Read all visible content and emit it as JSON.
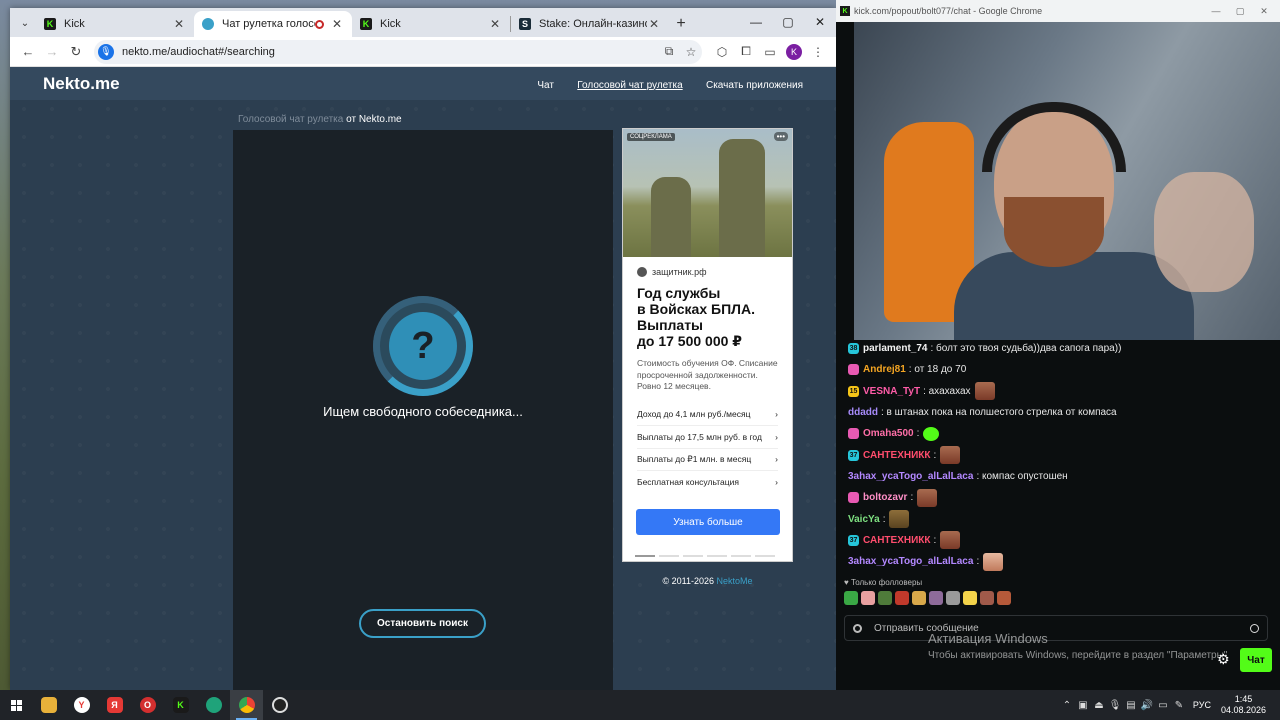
{
  "browser": {
    "tabs": [
      {
        "title": "Kick",
        "icon": "kick-icon",
        "active": false
      },
      {
        "title": "Чат рулетка голосовая — ",
        "icon": "nekto-icon",
        "active": true,
        "recording": true
      },
      {
        "title": "Kick",
        "icon": "kick-icon",
        "active": false
      },
      {
        "title": "Stake: Онлайн-казино и ставк",
        "icon": "stake-icon",
        "active": false
      }
    ],
    "url": "nekto.me/audiochat#/searching",
    "profile_initial": "K"
  },
  "site": {
    "logo": "Nekto.me",
    "nav": [
      "Чат",
      "Голосовой чат рулетка",
      "Скачать приложения"
    ],
    "breadcrumb_link": "Голосовой чат рулетка",
    "breadcrumb_rest": " от Nekto.me",
    "spinner_symbol": "?",
    "searching_text": "Ищем свободного собеседника...",
    "stop_button": "Остановить поиск",
    "copyright_prefix": "© 2011-2026 ",
    "copyright_link": "NektoMe"
  },
  "ad": {
    "badge": "СОЦРЕКЛАМА",
    "more": "•••",
    "source": "защитник.рф",
    "title_lines": [
      "Год службы",
      "в Войсках БПЛА.",
      "Выплаты",
      "до 17 500 000 ₽"
    ],
    "description": "Стоимость обучения ОФ. Списание просроченной задолженности. Ровно 12 месяцев.",
    "items": [
      "Доход до 4,1 млн руб./месяц",
      "Выплаты до 17,5 млн руб. в год",
      "Выплаты до ₽1 млн. в месяц",
      "Бесплатная консультация"
    ],
    "cta": "Узнать больше"
  },
  "popout": {
    "title": "kick.com/popout/bolt077/chat - Google Chrome",
    "messages": [
      {
        "badge": "b-cyan",
        "badge_text": "38",
        "user": "parlament_74",
        "color": "#f4f4f4",
        "text": ": болт это твоя судьба))два сапога пара))",
        "emote": ""
      },
      {
        "badge": "b-pink",
        "badge_text": "",
        "user": "Andrej81",
        "color": "#f5a623",
        "text": ": от 18 до 70",
        "emote": ""
      },
      {
        "badge": "b-yellow",
        "badge_text": "15",
        "user": "VESNA_TyT",
        "color": "#ff5ca8",
        "text": ": ахахахах",
        "emote": "em-face"
      },
      {
        "badge": "",
        "badge_text": "",
        "user": "ddadd",
        "color": "#a78bfa",
        "text": ": в штанах пока на полшестого стрелка от компаса",
        "emote": ""
      },
      {
        "badge": "b-pink",
        "badge_text": "",
        "user": "Omaha500",
        "color": "#ff6fa8",
        "text": ":",
        "emote": "em-cat"
      },
      {
        "badge": "b-cyan",
        "badge_text": "37",
        "user": "САНТЕХНИКК",
        "color": "#ff4d6d",
        "text": ":",
        "emote": "em-face"
      },
      {
        "badge": "",
        "badge_text": "",
        "user": "3ahax_ycaTogo_alLalLaca",
        "color": "#b388ff",
        "text": ": компас опустошен",
        "emote": ""
      },
      {
        "badge": "b-pink",
        "badge_text": "",
        "user": "boltozavr",
        "color": "#ff8fc7",
        "text": ":",
        "emote": "em-face"
      },
      {
        "badge": "",
        "badge_text": "",
        "user": "VaicYa",
        "color": "#7ee081",
        "text": ":",
        "emote": "em-dog"
      },
      {
        "badge": "b-cyan",
        "badge_text": "37",
        "user": "САНТЕХНИКК",
        "color": "#ff4d6d",
        "text": ":",
        "emote": "em-face"
      },
      {
        "badge": "",
        "badge_text": "",
        "user": "3ahax_ycaTogo_alLalLaca",
        "color": "#b388ff",
        "text": ":",
        "emote": "em-smile"
      }
    ],
    "followers_only": "♥ Только фолловеры",
    "input_placeholder": "Отправить сообщение",
    "send_button": "Чат"
  },
  "windows_activation": {
    "title": "Активация Windows",
    "subtitle": "Чтобы активировать Windows, перейдите в раздел \"Параметры\""
  },
  "taskbar": {
    "language": "РУС",
    "time": "1:45",
    "date": "04.08.2026"
  }
}
